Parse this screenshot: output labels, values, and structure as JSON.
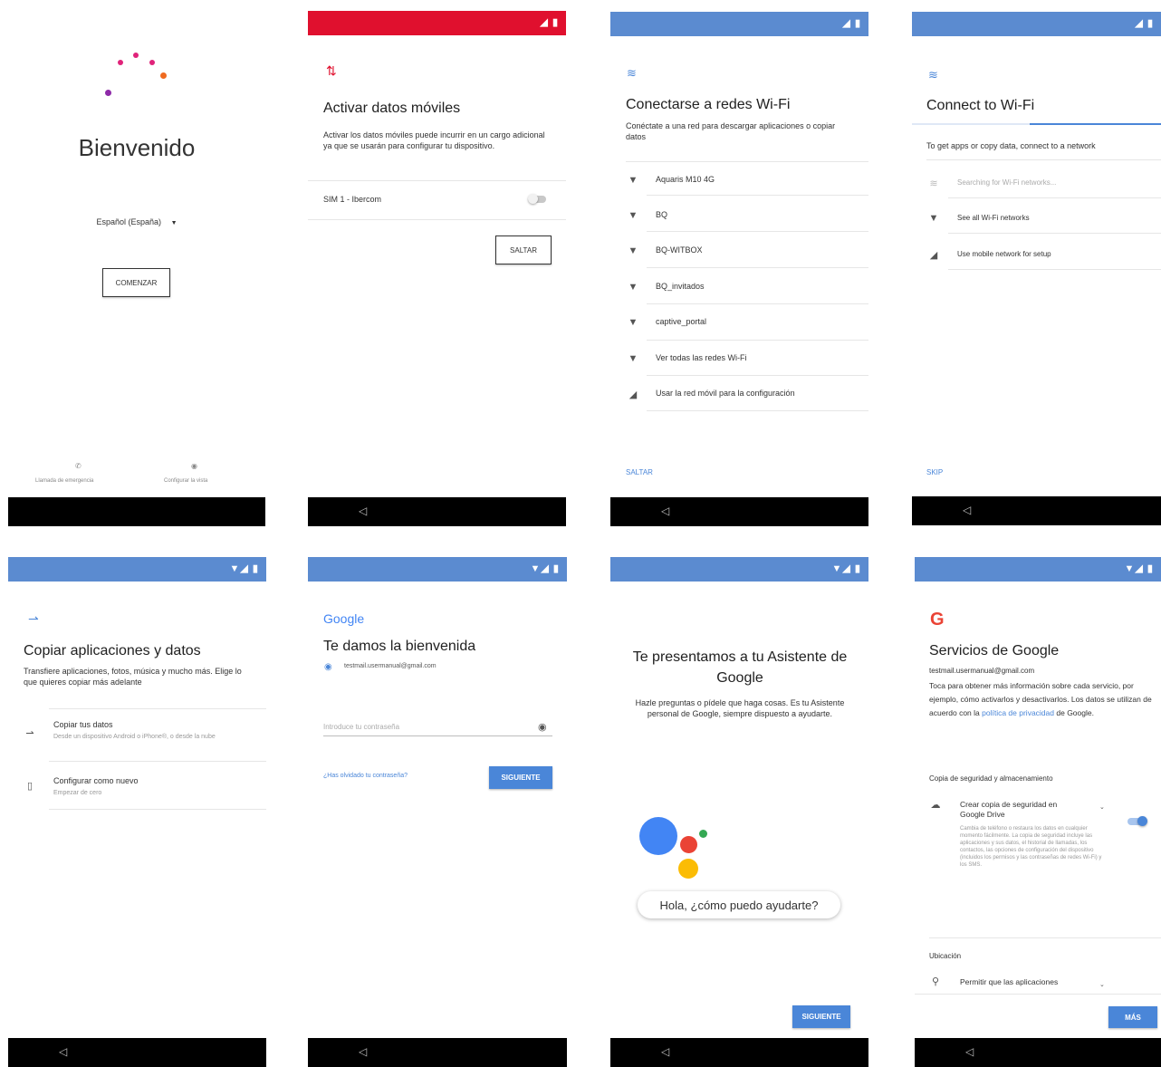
{
  "screens": {
    "welcome": {
      "title": "Bienvenido",
      "language": "Español (España)",
      "start_button": "COMENZAR",
      "emergency_call": "Llamada de emergencia",
      "vision_settings": "Configurar la vista",
      "dot_colors": [
        "#e0237a",
        "#8e2aa8",
        "#ef6a1f"
      ]
    },
    "mobile_data": {
      "title": "Activar datos móviles",
      "description": "Activar los datos móviles puede incurrir en un cargo adicional ya que se usarán para configurar tu dispositivo.",
      "sim_label": "SIM 1 - Ibercom",
      "skip_button": "SALTAR"
    },
    "wifi_es": {
      "title": "Conectarse a redes Wi-Fi",
      "subtitle": "Conéctate a una red para descargar aplicaciones o copiar datos",
      "networks": [
        {
          "label": "Aquaris M10 4G"
        },
        {
          "label": "BQ"
        },
        {
          "label": "BQ-WITBOX"
        },
        {
          "label": "BQ_invitados"
        },
        {
          "label": "captive_portal"
        },
        {
          "label": "Ver todas las redes Wi-Fi"
        },
        {
          "label": "Usar la red móvil para la configuración"
        }
      ],
      "skip": "SALTAR"
    },
    "wifi_en": {
      "title": "Connect to Wi-Fi",
      "subtitle": "To get apps or copy data, connect to a network",
      "searching": "Searching for Wi-Fi networks...",
      "see_all": "See all Wi-Fi networks",
      "mobile": "Use mobile network for setup",
      "skip": "SKIP"
    },
    "copy_apps": {
      "title": "Copiar aplicaciones y datos",
      "description": "Transfiere aplicaciones, fotos, música y mucho más. Elige lo que quieres copiar más adelante",
      "copy_title": "Copiar tus datos",
      "copy_hint": "Desde un dispositivo Android o iPhone®, o desde la nube",
      "new_title": "Configurar como nuevo",
      "new_hint": "Empezar de cero"
    },
    "google_signin": {
      "logo": "Google",
      "title": "Te damos la bienvenida",
      "email": "testmail.usermanual@gmail.com",
      "password_placeholder": "Introduce tu contraseña",
      "forgot": "¿Has olvidado tu contraseña?",
      "next": "SIGUIENTE"
    },
    "assistant": {
      "title": "Te presentamos a tu Asistente de Google",
      "description": "Hazle preguntas o pídele que haga cosas. Es tu Asistente personal de Google, siempre dispuesto a ayudarte.",
      "bubble": "Hola, ¿cómo puedo ayudarte?",
      "next": "SIGUIENTE"
    },
    "google_services": {
      "title": "Servicios de Google",
      "email": "testmail.usermanual@gmail.com",
      "intro": "Toca para obtener más información sobre cada servicio, por ejemplo, cómo activarlos y desactivarlos. Los datos se utilizan de acuerdo con la",
      "privacy_link": "política de privacidad",
      "intro_end": "de Google.",
      "backup_header": "Copia de seguridad y almacenamiento",
      "backup_title": "Crear copia de seguridad en Google Drive",
      "backup_hint": "Cambia de teléfono o restaura los datos en cualquier momento fácilmente. La copia de seguridad incluye las aplicaciones y sus datos, el historial de llamadas, los contactos, las opciones de configuración del dispositivo (incluidos los permisos y las contraseñas de redes Wi-Fi) y los SMS.",
      "location_header": "Ubicación",
      "location_title": "Permitir que las aplicaciones",
      "more": "MÁS"
    }
  },
  "colors": {
    "status_blue": "#5b8bd0",
    "status_red": "#e0102e",
    "accent_blue": "#4a86d8",
    "google_blue": "#4285f4",
    "google_red": "#ea4335",
    "google_yellow": "#fbbc05",
    "google_green": "#34a853"
  }
}
